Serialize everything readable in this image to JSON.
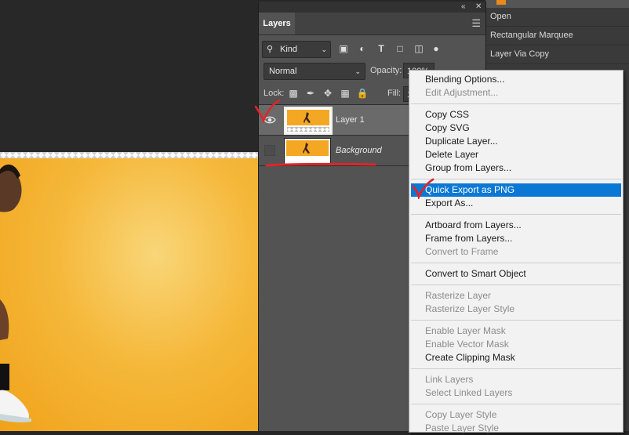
{
  "history": {
    "items": [
      "Open",
      "Rectangular Marquee",
      "Layer Via Copy"
    ]
  },
  "panel": {
    "tab_label": "Layers",
    "filter": {
      "kind_label": "Kind"
    },
    "blend_mode": "Normal",
    "opacity_label": "Opacity:",
    "opacity_value": "100%",
    "lock_label": "Lock:",
    "fill_label": "Fill:",
    "fill_value": "1",
    "layers": [
      {
        "name": "Layer 1",
        "visible": true,
        "selected": true
      },
      {
        "name": "Background",
        "visible": false,
        "selected": false
      }
    ]
  },
  "context_menu": {
    "groups": [
      [
        {
          "label": "Blending Options...",
          "enabled": true
        },
        {
          "label": "Edit Adjustment...",
          "enabled": false
        }
      ],
      [
        {
          "label": "Copy CSS",
          "enabled": true
        },
        {
          "label": "Copy SVG",
          "enabled": true
        },
        {
          "label": "Duplicate Layer...",
          "enabled": true
        },
        {
          "label": "Delete Layer",
          "enabled": true
        },
        {
          "label": "Group from Layers...",
          "enabled": true
        }
      ],
      [
        {
          "label": "Quick Export as PNG",
          "enabled": true,
          "highlighted": true
        },
        {
          "label": "Export As...",
          "enabled": true
        }
      ],
      [
        {
          "label": "Artboard from Layers...",
          "enabled": true
        },
        {
          "label": "Frame from Layers...",
          "enabled": true
        },
        {
          "label": "Convert to Frame",
          "enabled": false
        }
      ],
      [
        {
          "label": "Convert to Smart Object",
          "enabled": true
        }
      ],
      [
        {
          "label": "Rasterize Layer",
          "enabled": false
        },
        {
          "label": "Rasterize Layer Style",
          "enabled": false
        }
      ],
      [
        {
          "label": "Enable Layer Mask",
          "enabled": false
        },
        {
          "label": "Enable Vector Mask",
          "enabled": false
        },
        {
          "label": "Create Clipping Mask",
          "enabled": true
        }
      ],
      [
        {
          "label": "Link Layers",
          "enabled": false
        },
        {
          "label": "Select Linked Layers",
          "enabled": false
        }
      ],
      [
        {
          "label": "Copy Layer Style",
          "enabled": false
        },
        {
          "label": "Paste Layer Style",
          "enabled": false
        }
      ]
    ]
  },
  "colors": {
    "menu_highlight": "#0a78d4",
    "annotation_red": "#e0252a",
    "canvas_orange": "#f3a722"
  },
  "icons": {
    "filter": [
      "image-filter-icon",
      "adjustment-filter-icon",
      "type-filter-icon",
      "shape-filter-icon",
      "smart-object-filter-icon",
      "filter-toggle-icon"
    ],
    "lock": [
      "lock-transparent-icon",
      "lock-image-icon",
      "lock-position-icon",
      "lock-artboard-icon",
      "lock-all-icon"
    ]
  }
}
